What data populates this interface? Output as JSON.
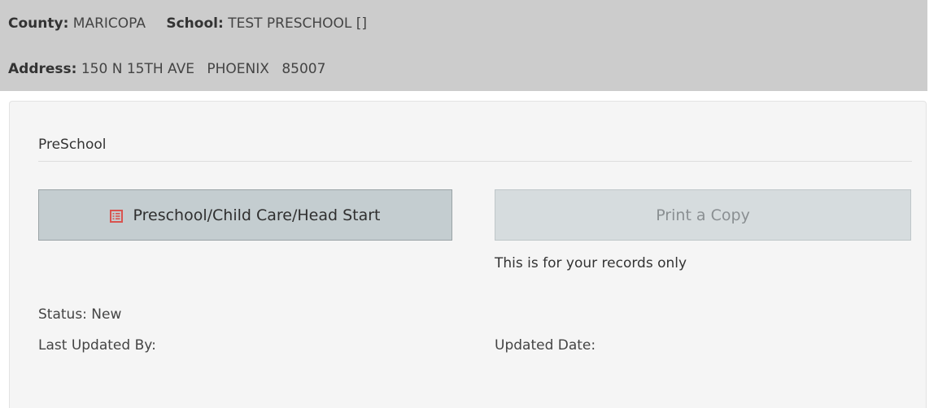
{
  "header": {
    "county_label": "County:",
    "county_value": "MARICOPA",
    "school_label": "School:",
    "school_value": "TEST PRESCHOOL []",
    "address_label": "Address:",
    "address_street": "150 N 15TH AVE",
    "address_city": "PHOENIX",
    "address_zip": "85007"
  },
  "panel": {
    "section_title": "PreSchool",
    "form_button_label": "Preschool/Child Care/Head Start",
    "form_button_icon": "list-icon",
    "print_button_label": "Print a Copy",
    "records_note": "This is for your records only",
    "status_text": "Status: New",
    "last_updated_by_label": "Last Updated By:",
    "updated_date_label": "Updated Date:"
  },
  "colors": {
    "header_bg": "#cccccc",
    "panel_bg": "#f5f5f5",
    "form_button_bg": "#c4cdd0",
    "print_button_bg": "#d6dcde",
    "icon_red": "#d9534f"
  }
}
